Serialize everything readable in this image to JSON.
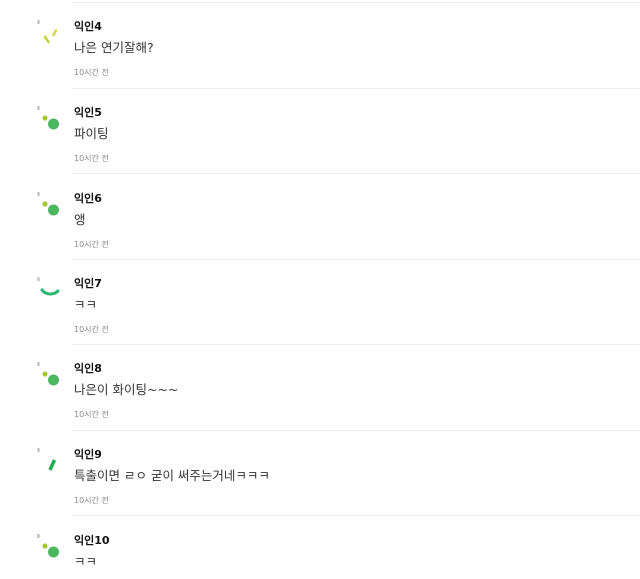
{
  "comments": [
    {
      "author": "익인4",
      "body": "나은 연기잘해?",
      "time": "10시간 전",
      "avatar_icon": "loading-dash-icon",
      "avatar_color": "#c6d23a"
    },
    {
      "author": "익인5",
      "body": "파이팅",
      "time": "10시간 전",
      "avatar_icon": "dot-cluster-icon",
      "avatar_color": "#4bb85f"
    },
    {
      "author": "익인6",
      "body": "앵",
      "time": "10시간 전",
      "avatar_icon": "dot-cluster-icon",
      "avatar_color": "#4bb85f"
    },
    {
      "author": "익인7",
      "body": "ㅋㅋ",
      "time": "10시간 전",
      "avatar_icon": "arc-icon",
      "avatar_color": "#2bb673"
    },
    {
      "author": "익인8",
      "body": "나은이 화이팅~~~",
      "time": "10시간 전",
      "avatar_icon": "dot-cluster-icon",
      "avatar_color": "#4bb85f"
    },
    {
      "author": "익인9",
      "body": "특출이면 ㄹㅇ 굳이 써주는거네ㅋㅋㅋ",
      "time": "10시간 전",
      "avatar_icon": "slash-bar-icon",
      "avatar_color": "#1fae55"
    },
    {
      "author": "익인10",
      "body": "ㅋㅋ",
      "time": "",
      "avatar_icon": "dot-cluster-icon",
      "avatar_color": "#4bb85f"
    }
  ]
}
